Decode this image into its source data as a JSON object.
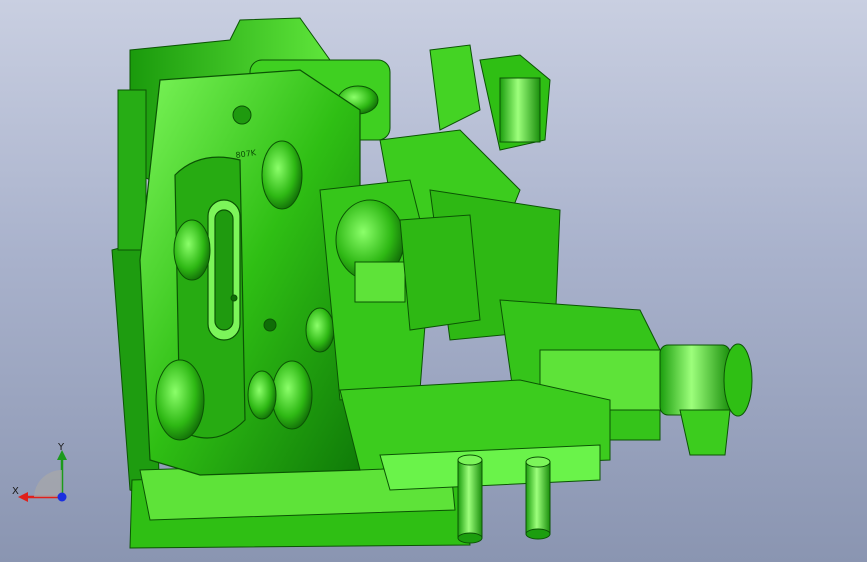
{
  "viewport": {
    "background_top": "#c9cfe1",
    "background_bottom": "#8a95b1"
  },
  "model": {
    "color_base": "#2fbf14",
    "color_light": "#6af34a",
    "color_dark": "#0d6b06",
    "engraving": "807K"
  },
  "triad": {
    "x_label": "X",
    "y_label": "Y",
    "x_color": "#e0201b",
    "y_color": "#1c9a1c",
    "z_color": "#1b2fe0"
  }
}
